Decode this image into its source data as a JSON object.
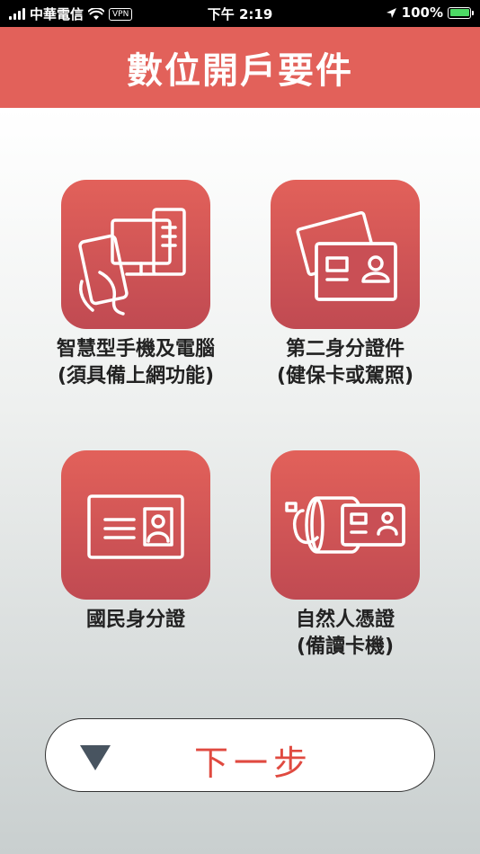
{
  "status_bar": {
    "carrier": "中華電信",
    "vpn": "VPN",
    "time": "下午 2:19",
    "battery": "100%"
  },
  "header": {
    "title": "數位開戶要件"
  },
  "tiles": [
    {
      "line1": "智慧型手機及電腦",
      "line2": "(須具備上網功能)",
      "icon": "phone-computer-icon"
    },
    {
      "line1": "第二身分證件",
      "line2": "(健保卡或駕照)",
      "icon": "cards-icon"
    },
    {
      "line1": "國民身分證",
      "line2": "",
      "icon": "id-card-icon"
    },
    {
      "line1": "自然人憑證",
      "line2": "(備讀卡機)",
      "icon": "card-reader-icon"
    }
  ],
  "next_button": {
    "label": "下一步"
  },
  "colors": {
    "accent": "#e2615a",
    "button_text": "#e04a40",
    "arrow": "#485460"
  }
}
